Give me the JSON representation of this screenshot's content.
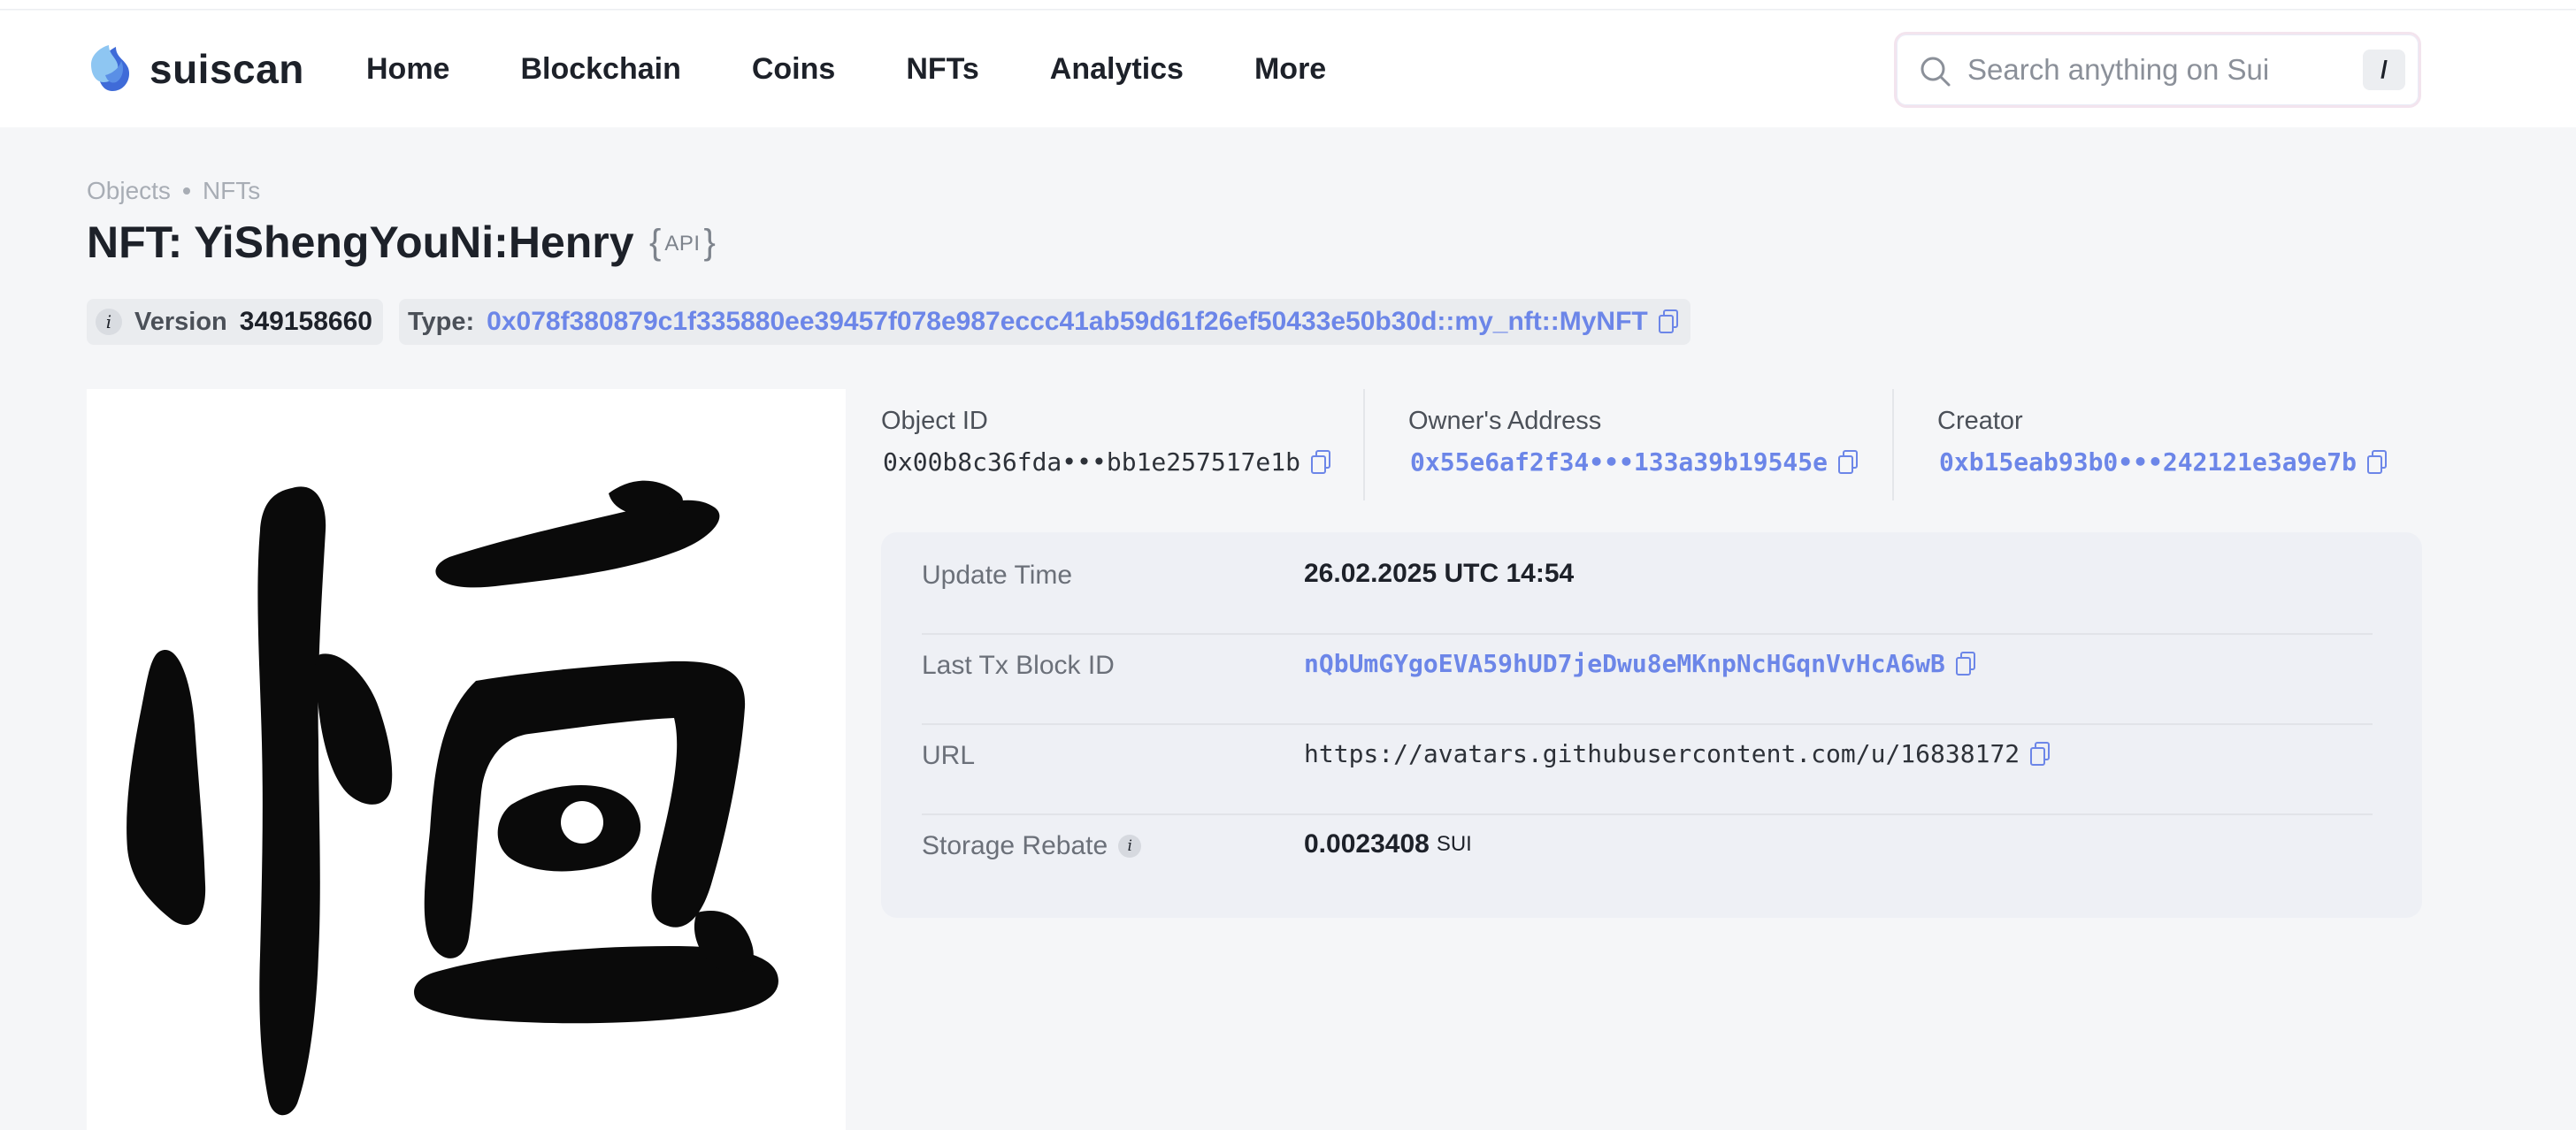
{
  "header": {
    "logo_text": "suiscan",
    "nav": [
      "Home",
      "Blockchain",
      "Coins",
      "NFTs",
      "Analytics",
      "More"
    ],
    "search": {
      "placeholder": "Search anything on Sui",
      "shortcut": "/"
    }
  },
  "breadcrumb": [
    "Objects",
    "NFTs"
  ],
  "title": "NFT: YiShengYouNi:Henry",
  "api_badge": {
    "open": "{",
    "label": "API",
    "close": "}"
  },
  "chips": {
    "version_label": "Version",
    "version_value": "349158660",
    "type_label": "Type:",
    "type_value": "0x078f380879c1f335880ee39457f078e987eccc41ab59d61f26ef50433e50b30d::my_nft::MyNFT"
  },
  "ids": {
    "object": {
      "label": "Object ID",
      "value": "0x00b8c36fda•••bb1e257517e1b"
    },
    "owner": {
      "label": "Owner's Address",
      "value": "0x55e6af2f34•••133a39b19545e"
    },
    "creator": {
      "label": "Creator",
      "value": "0xb15eab93b0•••242121e3a9e7b"
    }
  },
  "details": {
    "update_time": {
      "label": "Update Time",
      "value": "26.02.2025 UTC 14:54"
    },
    "last_tx": {
      "label": "Last Tx Block ID",
      "value": "nQbUmGYgoEVA59hUD7jeDwu8eMKnpNcHGqnVvHcA6wB"
    },
    "url": {
      "label": "URL",
      "value": "https://avatars.githubusercontent.com/u/16838172"
    },
    "storage_rebate": {
      "label": "Storage Rebate",
      "value": "0.0023408",
      "unit": "SUI"
    }
  },
  "colors": {
    "link": "#6c86e8",
    "page_bg": "#f5f6f8",
    "card_bg": "#eef0f5"
  },
  "icons": [
    "sui-logo-icon",
    "search-icon",
    "info-icon",
    "copy-icon"
  ]
}
